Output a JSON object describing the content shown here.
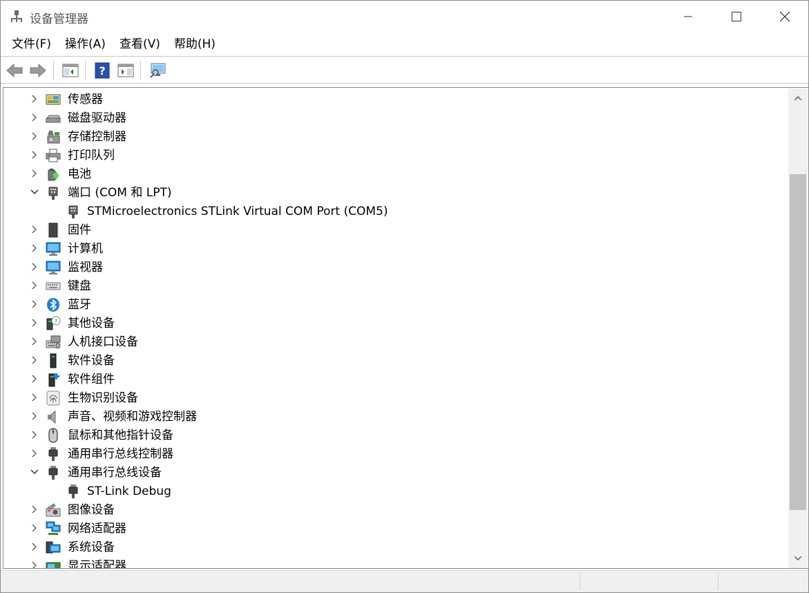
{
  "window": {
    "title": "设备管理器",
    "minimize_icon": "minimize-icon",
    "maximize_icon": "maximize-icon",
    "close_icon": "close-icon"
  },
  "menu": {
    "items": [
      "文件(F)",
      "操作(A)",
      "查看(V)",
      "帮助(H)"
    ]
  },
  "toolbar": {
    "buttons": [
      "back-arrow-icon",
      "forward-arrow-icon",
      "properties-pane-icon",
      "help-icon",
      "run-pane-icon",
      "scan-monitor-icon"
    ]
  },
  "tree": {
    "nodes": [
      {
        "label": "传感器",
        "icon": "sensor-icon",
        "state": "collapsed"
      },
      {
        "label": "磁盘驱动器",
        "icon": "disk-drive-icon",
        "state": "collapsed"
      },
      {
        "label": "存储控制器",
        "icon": "storage-controller-icon",
        "state": "collapsed"
      },
      {
        "label": "打印队列",
        "icon": "printer-icon",
        "state": "collapsed"
      },
      {
        "label": "电池",
        "icon": "battery-icon",
        "state": "collapsed"
      },
      {
        "label": "端口 (COM 和 LPT)",
        "icon": "port-icon",
        "state": "expanded"
      },
      {
        "label": "STMicroelectronics STLink Virtual COM Port (COM5)",
        "icon": "port-icon",
        "state": "child"
      },
      {
        "label": "固件",
        "icon": "firmware-chip-icon",
        "state": "collapsed"
      },
      {
        "label": "计算机",
        "icon": "computer-monitor-icon",
        "state": "collapsed"
      },
      {
        "label": "监视器",
        "icon": "monitor-icon",
        "state": "collapsed"
      },
      {
        "label": "键盘",
        "icon": "keyboard-icon",
        "state": "collapsed"
      },
      {
        "label": "蓝牙",
        "icon": "bluetooth-icon",
        "state": "collapsed"
      },
      {
        "label": "其他设备",
        "icon": "unknown-device-icon",
        "state": "collapsed"
      },
      {
        "label": "人机接口设备",
        "icon": "hid-device-icon",
        "state": "collapsed"
      },
      {
        "label": "软件设备",
        "icon": "software-device-icon",
        "state": "collapsed"
      },
      {
        "label": "软件组件",
        "icon": "software-component-icon",
        "state": "collapsed"
      },
      {
        "label": "生物识别设备",
        "icon": "fingerprint-icon",
        "state": "collapsed"
      },
      {
        "label": "声音、视频和游戏控制器",
        "icon": "speaker-icon",
        "state": "collapsed"
      },
      {
        "label": "鼠标和其他指针设备",
        "icon": "mouse-icon",
        "state": "collapsed"
      },
      {
        "label": "通用串行总线控制器",
        "icon": "usb-plug-icon",
        "state": "collapsed"
      },
      {
        "label": "通用串行总线设备",
        "icon": "usb-plug-icon",
        "state": "expanded"
      },
      {
        "label": "ST-Link Debug",
        "icon": "usb-plug-icon",
        "state": "child"
      },
      {
        "label": "图像设备",
        "icon": "camera-icon",
        "state": "collapsed"
      },
      {
        "label": "网络适配器",
        "icon": "network-adapter-icon",
        "state": "collapsed"
      },
      {
        "label": "系统设备",
        "icon": "system-device-icon",
        "state": "collapsed"
      },
      {
        "label": "显示适配器",
        "icon": "display-adapter-icon",
        "state": "collapsed"
      }
    ]
  },
  "colors": {
    "accent_blue": "#1e7fd6",
    "scroll_thumb": "#c1c1c1",
    "statusbar_bg": "#f0f0f0"
  }
}
